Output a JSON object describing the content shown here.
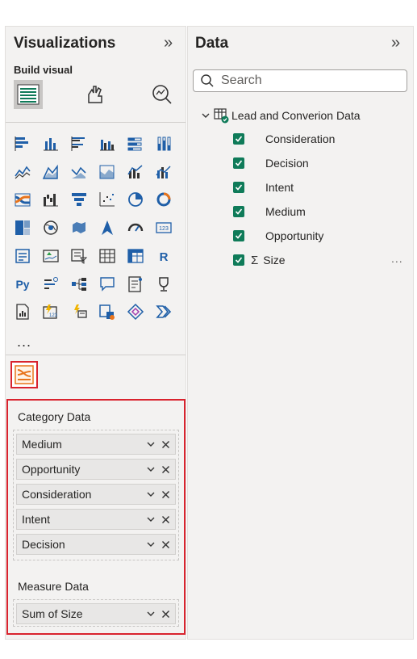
{
  "visualizations": {
    "title": "Visualizations",
    "collapse_icon": "double-chevron-right-icon",
    "build_label": "Build visual",
    "modes": [
      {
        "name": "build-visual-mode",
        "icon": "fields-grid-icon",
        "active": true
      },
      {
        "name": "format-visual-mode",
        "icon": "paintbrush-hand-icon",
        "active": false
      },
      {
        "name": "analytics-mode",
        "icon": "magnifier-chart-icon",
        "active": false
      }
    ],
    "visual_icons": [
      "stacked-bar-chart",
      "stacked-column-chart",
      "clustered-bar-chart",
      "clustered-column-chart",
      "100-stacked-bar-chart",
      "100-stacked-column-chart",
      "line-chart",
      "area-chart",
      "stacked-area-chart",
      "100-stacked-area-chart",
      "line-clustered-column-chart",
      "line-stacked-column-chart",
      "ribbon-chart",
      "waterfall-chart",
      "funnel-chart",
      "scatter-chart",
      "pie-chart",
      "donut-chart",
      "treemap",
      "map",
      "filled-map",
      "azure-map",
      "gauge",
      "card",
      "multi-row-card",
      "kpi",
      "slicer",
      "table",
      "matrix",
      "r-script-visual",
      "python-visual",
      "key-influencers",
      "decomposition-tree",
      "qa-visual",
      "smart-narrative",
      "metrics",
      "paginated-report",
      "power-apps",
      "power-automate",
      "custom-visual-a",
      "custom-visual-b",
      "custom-visual-c"
    ],
    "more_label": "...",
    "custom_visual_icon": "sankey-custom-visual-icon",
    "wells": {
      "category_label": "Category Data",
      "category_fields": [
        "Medium",
        "Opportunity",
        "Consideration",
        "Intent",
        "Decision"
      ],
      "measure_label": "Measure Data",
      "measure_fields": [
        "Sum of Size"
      ]
    }
  },
  "data_pane": {
    "title": "Data",
    "collapse_icon": "double-chevron-right-icon",
    "search_placeholder": "Search",
    "table_name": "Lead and Converion Data",
    "fields": [
      {
        "label": "Consideration",
        "checked": true,
        "sigma": false
      },
      {
        "label": "Decision",
        "checked": true,
        "sigma": false
      },
      {
        "label": "Intent",
        "checked": true,
        "sigma": false
      },
      {
        "label": "Medium",
        "checked": true,
        "sigma": false
      },
      {
        "label": "Opportunity",
        "checked": true,
        "sigma": false
      },
      {
        "label": "Size",
        "checked": true,
        "sigma": true
      }
    ],
    "more_label": "..."
  },
  "colors": {
    "accent_green": "#0f7b59",
    "highlight_red": "#d9232e",
    "icon_blue": "#1f5fa8",
    "icon_orange": "#e8741c"
  }
}
